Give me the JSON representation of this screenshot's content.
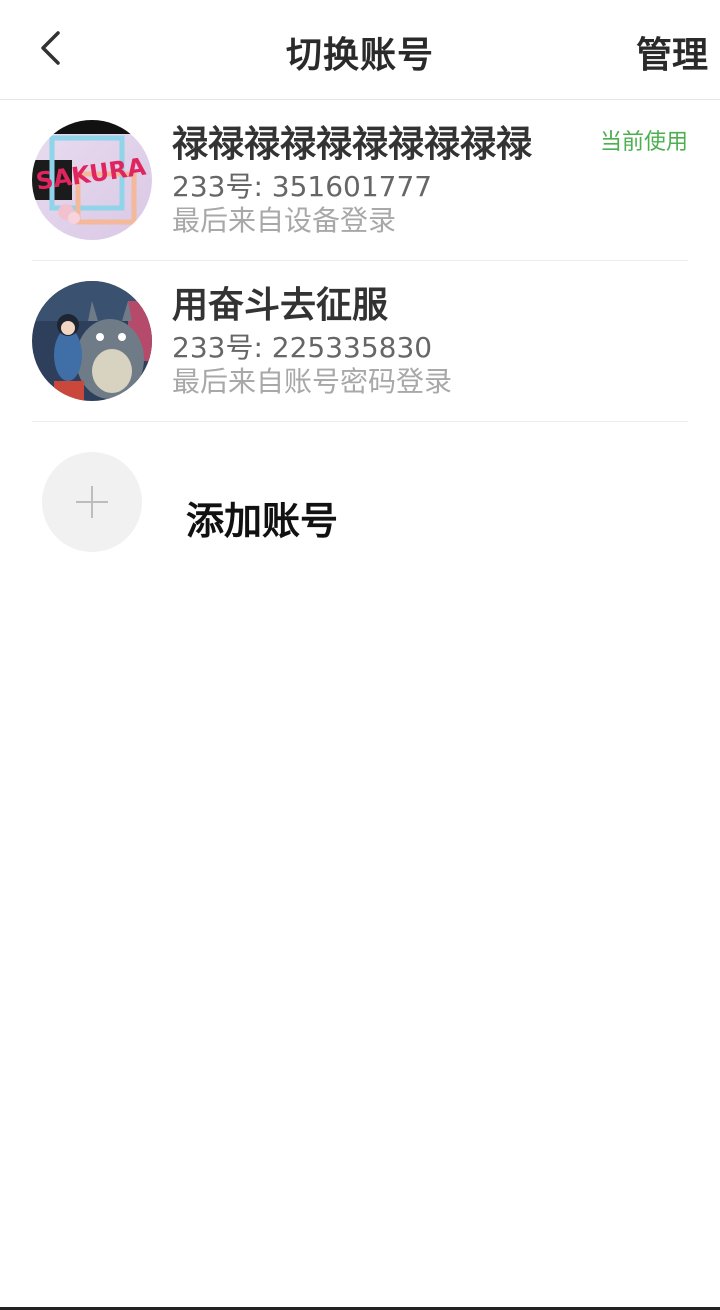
{
  "header": {
    "title": "切换账号",
    "back_icon": "chevron-left-icon",
    "manage_label": "管理"
  },
  "accounts": [
    {
      "name": "禄禄禄禄禄禄禄禄禄禄",
      "id_text": "233号: 351601777",
      "login_source": "最后来自设备登录",
      "badge": "当前使用",
      "avatar_text": "SAKURA"
    },
    {
      "name": "用奋斗去征服",
      "id_text": "233号: 225335830",
      "login_source": "最后来自账号密码登录"
    }
  ],
  "add_account": {
    "label": "添加账号",
    "icon": "plus-icon"
  },
  "colors": {
    "accent_green": "#4caf50",
    "title_text": "#2a2a2a",
    "secondary_text": "#666666",
    "tertiary_text": "#a8a8a8"
  }
}
